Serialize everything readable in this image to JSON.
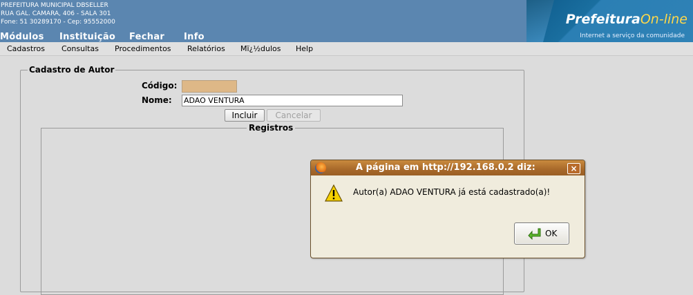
{
  "header": {
    "org_name": "PREFEITURA MUNICIPAL DBSELLER",
    "address": "RUA GAL. CAMARA, 406 - SALA 301",
    "contact": "Fone: 51 30289170  -  Cep: 95552000",
    "top_menu": [
      "Módulos",
      "Instituição",
      "Fechar",
      "Info"
    ],
    "logo_text_bold": "Prefeitura",
    "logo_text_online": "On-line",
    "logo_tagline": "Internet a serviço da comunidade"
  },
  "menubar": {
    "items": [
      "Cadastros",
      "Consultas",
      "Procedimentos",
      "Relatórios",
      "Mï¿½dulos",
      "Help"
    ]
  },
  "form": {
    "legend": "Cadastro de Autor",
    "codigo_label": "Código:",
    "codigo_value": "",
    "nome_label": "Nome:",
    "nome_value": "ADAO VENTURA",
    "incluir_label": "Incluir",
    "cancelar_label": "Cancelar",
    "registros_legend": "Registros"
  },
  "dialog": {
    "title": "A página em http://192.168.0.2 diz:",
    "message": "Autor(a) ADAO VENTURA já está cadastrado(a)!",
    "ok_label": "OK",
    "close_icon": "close-icon",
    "warning_icon": "warning-icon"
  },
  "colors": {
    "header_bg": "#5b86b0",
    "dialog_title": "#a8692a",
    "codigo_bg": "#deb887"
  }
}
